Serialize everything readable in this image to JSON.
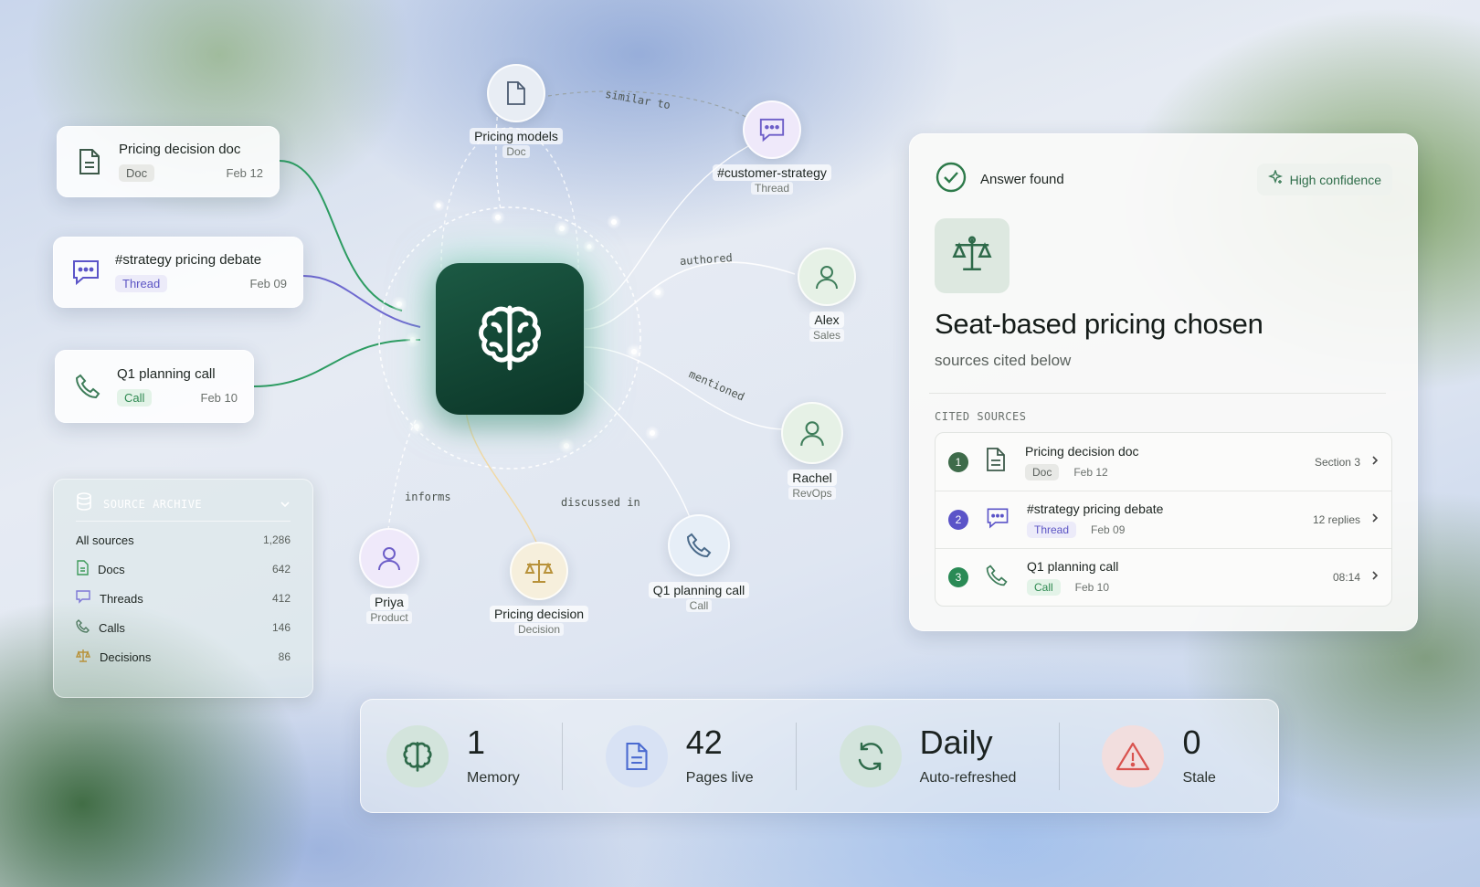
{
  "sources": [
    {
      "title": "Pricing decision doc",
      "tag": "Doc",
      "date": "Feb 12",
      "icon": "document-icon"
    },
    {
      "title": "#strategy pricing debate",
      "tag": "Thread",
      "date": "Feb 09",
      "icon": "chat-icon"
    },
    {
      "title": "Q1 planning call",
      "tag": "Call",
      "date": "Feb 10",
      "icon": "phone-icon"
    }
  ],
  "archive": {
    "title": "SOURCE ARCHIVE",
    "all_label": "All sources",
    "all_count": "1,286",
    "items": [
      {
        "label": "Docs",
        "count": "642",
        "icon": "document-icon"
      },
      {
        "label": "Threads",
        "count": "412",
        "icon": "chat-icon"
      },
      {
        "label": "Calls",
        "count": "146",
        "icon": "phone-icon"
      },
      {
        "label": "Decisions",
        "count": "86",
        "icon": "scales-icon"
      }
    ]
  },
  "graph": {
    "center_icon": "brain-icon",
    "nodes": [
      {
        "label": "Pricing models",
        "sub": "Doc"
      },
      {
        "label": "#customer-strategy",
        "sub": "Thread"
      },
      {
        "label": "Alex",
        "sub": "Sales"
      },
      {
        "label": "Rachel",
        "sub": "RevOps"
      },
      {
        "label": "Priya",
        "sub": "Product"
      },
      {
        "label": "Pricing decision",
        "sub": "Decision"
      },
      {
        "label": "Q1 planning call",
        "sub": "Call"
      }
    ],
    "edge_labels": [
      "similar to",
      "authored",
      "mentioned",
      "informs",
      "discussed in"
    ]
  },
  "answer": {
    "status": "Answer found",
    "confidence": "High confidence",
    "title": "Seat-based pricing chosen",
    "subtitle": "sources cited below",
    "cited_header": "CITED SOURCES",
    "cited": [
      {
        "n": "1",
        "title": "Pricing decision doc",
        "tag": "Doc",
        "date": "Feb 12",
        "meta": "Section 3"
      },
      {
        "n": "2",
        "title": "#strategy pricing debate",
        "tag": "Thread",
        "date": "Feb 09",
        "meta": "12 replies"
      },
      {
        "n": "3",
        "title": "Q1 planning call",
        "tag": "Call",
        "date": "Feb 10",
        "meta": "08:14"
      }
    ]
  },
  "stats": [
    {
      "value": "1",
      "label": "Memory",
      "icon": "brain-icon"
    },
    {
      "value": "42",
      "label": "Pages live",
      "icon": "document-icon"
    },
    {
      "value": "Daily",
      "label": "Auto-refreshed",
      "icon": "refresh-icon"
    },
    {
      "value": "0",
      "label": "Stale",
      "icon": "warning-icon"
    }
  ],
  "colors": {
    "brand": "#0f3d2e",
    "doc": "#3d5a4a",
    "thread": "#5b54c8",
    "call": "#2f8a52",
    "decision": "#b8923a",
    "warning": "#d9534f"
  }
}
